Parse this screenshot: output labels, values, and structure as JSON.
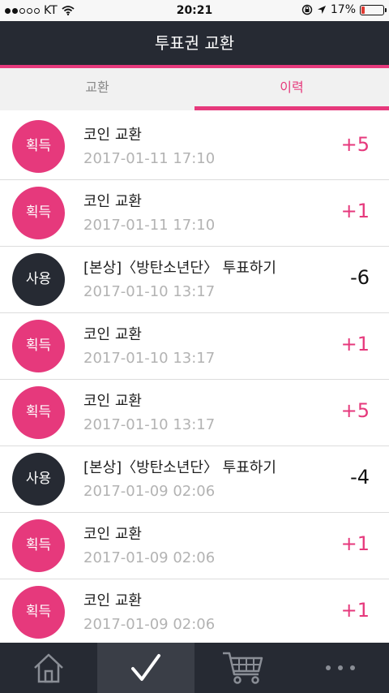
{
  "status_bar": {
    "carrier": "KT",
    "time": "20:21",
    "battery_percent": "17%",
    "battery_level": 0.17
  },
  "header": {
    "title": "투표권 교환"
  },
  "tabs": [
    {
      "label": "교환",
      "active": false
    },
    {
      "label": "이력",
      "active": true
    }
  ],
  "history": [
    {
      "badge": "획득",
      "type": "gain",
      "title": "코인 교환",
      "time": "2017-01-11 17:10",
      "amount": "+5"
    },
    {
      "badge": "획득",
      "type": "gain",
      "title": "코인 교환",
      "time": "2017-01-11 17:10",
      "amount": "+1"
    },
    {
      "badge": "사용",
      "type": "use",
      "title": "[본상]〈방탄소년단〉 투표하기",
      "time": "2017-01-10 13:17",
      "amount": "-6"
    },
    {
      "badge": "획득",
      "type": "gain",
      "title": "코인 교환",
      "time": "2017-01-10 13:17",
      "amount": "+1"
    },
    {
      "badge": "획득",
      "type": "gain",
      "title": "코인 교환",
      "time": "2017-01-10 13:17",
      "amount": "+5"
    },
    {
      "badge": "사용",
      "type": "use",
      "title": "[본상]〈방탄소년단〉 투표하기",
      "time": "2017-01-09 02:06",
      "amount": "-4"
    },
    {
      "badge": "획득",
      "type": "gain",
      "title": "코인 교환",
      "time": "2017-01-09 02:06",
      "amount": "+1"
    },
    {
      "badge": "획득",
      "type": "gain",
      "title": "코인 교환",
      "time": "2017-01-09 02:06",
      "amount": "+1"
    }
  ],
  "bottom_nav": [
    {
      "icon": "home-icon",
      "active": false
    },
    {
      "icon": "check-icon",
      "active": true
    },
    {
      "icon": "cart-icon",
      "active": false
    },
    {
      "icon": "more-icon",
      "active": false
    }
  ],
  "colors": {
    "accent": "#e6397c",
    "dark": "#262a33",
    "battery_low": "#e03a32"
  }
}
